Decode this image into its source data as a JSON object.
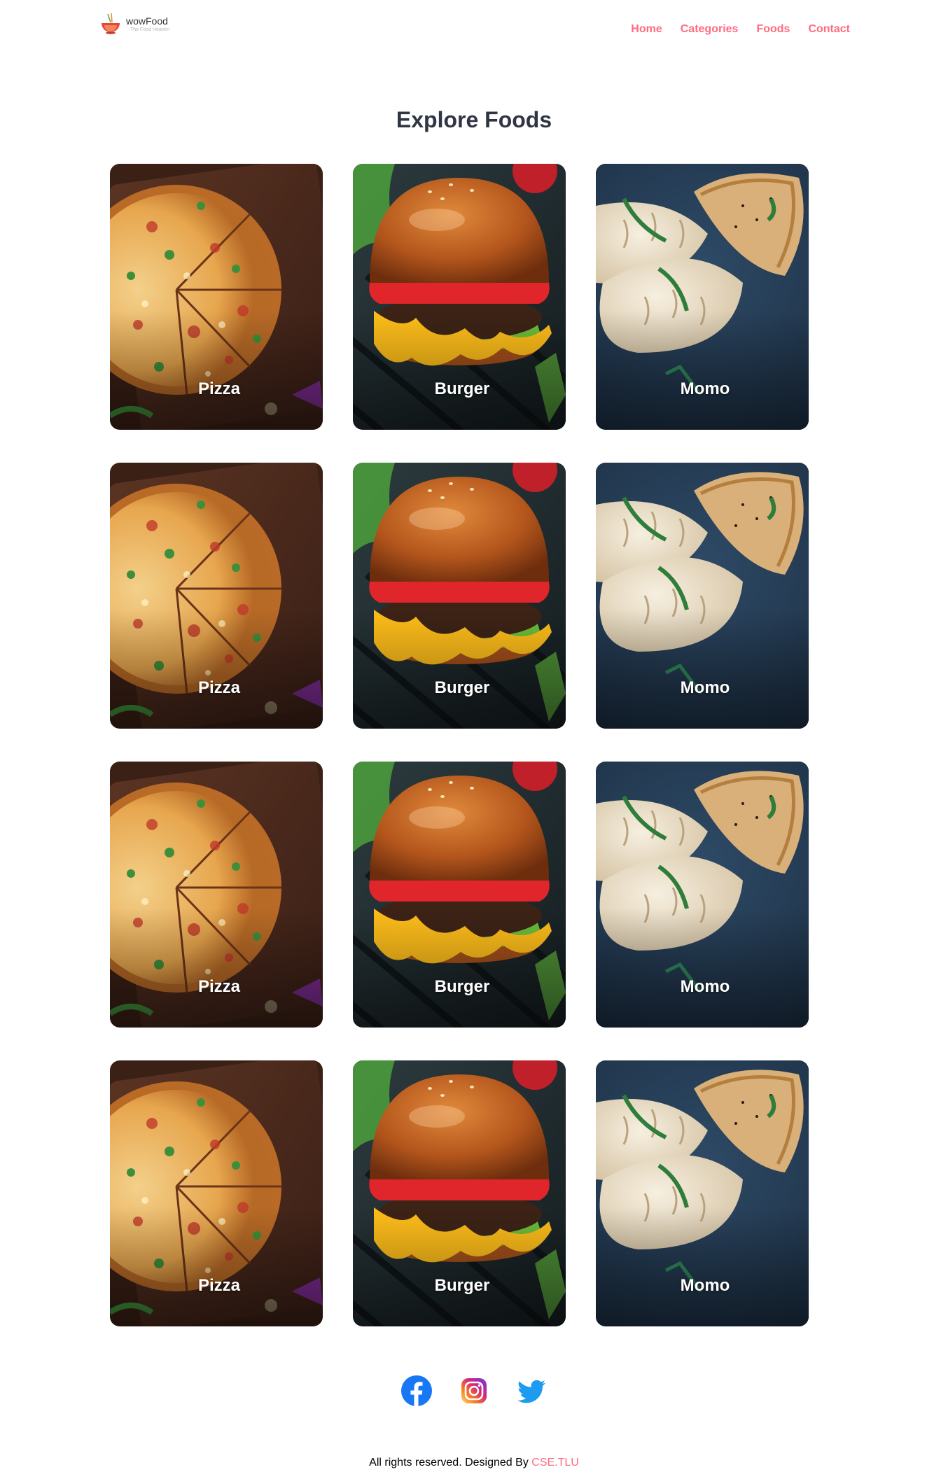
{
  "brand": {
    "name": "wowFood",
    "tagline": "The Food Heaven"
  },
  "nav": {
    "items": [
      {
        "label": "Home"
      },
      {
        "label": "Categories"
      },
      {
        "label": "Foods"
      },
      {
        "label": "Contact"
      }
    ],
    "color": "#ff6b81"
  },
  "main": {
    "title": "Explore Foods",
    "foods": [
      {
        "name": "Pizza",
        "image": "pizza"
      },
      {
        "name": "Burger",
        "image": "burger"
      },
      {
        "name": "Momo",
        "image": "momo"
      },
      {
        "name": "Pizza",
        "image": "pizza"
      },
      {
        "name": "Burger",
        "image": "burger"
      },
      {
        "name": "Momo",
        "image": "momo"
      },
      {
        "name": "Pizza",
        "image": "pizza"
      },
      {
        "name": "Burger",
        "image": "burger"
      },
      {
        "name": "Momo",
        "image": "momo"
      },
      {
        "name": "Pizza",
        "image": "pizza"
      },
      {
        "name": "Burger",
        "image": "burger"
      },
      {
        "name": "Momo",
        "image": "momo"
      }
    ]
  },
  "footer": {
    "social": [
      {
        "icon": "facebook-icon"
      },
      {
        "icon": "instagram-icon"
      },
      {
        "icon": "twitter-icon"
      }
    ],
    "copyright_text": "All rights reserved. Designed By ",
    "designer": "CSE.TLU"
  }
}
